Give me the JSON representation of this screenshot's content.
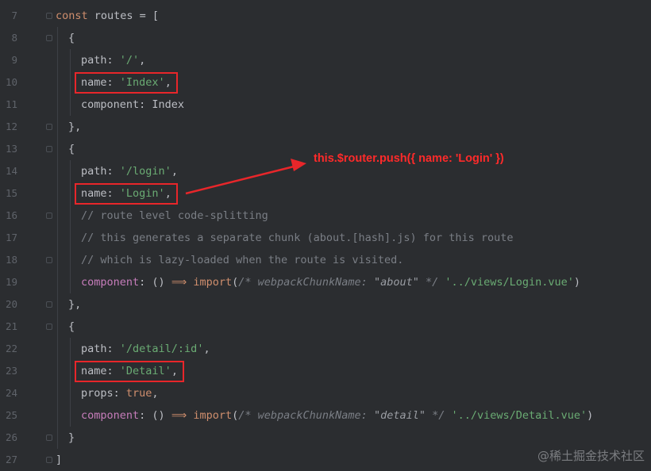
{
  "editor": {
    "line_numbers": [
      "7",
      "8",
      "9",
      "10",
      "11",
      "12",
      "13",
      "14",
      "15",
      "16",
      "17",
      "18",
      "19",
      "20",
      "21",
      "22",
      "23",
      "24",
      "25",
      "26",
      "27"
    ],
    "l7": {
      "kw": "const",
      "text": " routes = ["
    },
    "l8": {
      "text": "{"
    },
    "l9": {
      "key": "path",
      "colon": ": ",
      "val": "'/'",
      "tail": ","
    },
    "l10": {
      "key": "name",
      "colon": ": ",
      "val": "'Index'",
      "tail": ","
    },
    "l11": {
      "key": "component",
      "colon": ": ",
      "val": "Index"
    },
    "l12": {
      "text": "},"
    },
    "l13": {
      "text": "{"
    },
    "l14": {
      "key": "path",
      "colon": ": ",
      "val": "'/login'",
      "tail": ","
    },
    "l15": {
      "key": "name",
      "colon": ": ",
      "val": "'Login'",
      "tail": ","
    },
    "l16": {
      "comment": "// route level code-splitting"
    },
    "l17": {
      "comment": "// this generates a separate chunk (about.[hash].js) for this route"
    },
    "l18": {
      "comment": "// which is lazy-loaded when the route is visited."
    },
    "l19": {
      "key": "component",
      "colon": ": ",
      "paren": "() ",
      "arrow": "⟹",
      "import": "import",
      "open": "(",
      "cmt_start": "/* ",
      "cmt_key": "webpackChunkName: ",
      "cmt_val": "\"about\"",
      "cmt_end": " */",
      "path": " '../views/Login.vue'",
      "close": ")"
    },
    "l20": {
      "text": "},"
    },
    "l21": {
      "text": "{"
    },
    "l22": {
      "key": "path",
      "colon": ": ",
      "val": "'/detail/:id'",
      "tail": ","
    },
    "l23": {
      "key": "name",
      "colon": ": ",
      "val": "'Detail'",
      "tail": ","
    },
    "l24": {
      "key": "props",
      "colon": ": ",
      "val": "true",
      "tail": ","
    },
    "l25": {
      "key": "component",
      "colon": ": ",
      "paren": "() ",
      "arrow": "⟹",
      "import": "import",
      "open": "(",
      "cmt_start": "/* ",
      "cmt_key": "webpackChunkName: ",
      "cmt_val": "\"detail\"",
      "cmt_end": " */",
      "path": " '../views/Detail.vue'",
      "close": ")"
    },
    "l26": {
      "text": "}"
    },
    "l27": {
      "text": "]"
    }
  },
  "annotation": {
    "text": "this.$router.push({ name: 'Login' })",
    "color": "#ff2a2a"
  },
  "watermark": "@稀土掘金技术社区",
  "colors": {
    "background": "#2b2d30",
    "keyword": "#cf8e6d",
    "string": "#6aab73",
    "property": "#c77dbb",
    "comment": "#7a7e85",
    "highlight_box": "#e8262a"
  }
}
